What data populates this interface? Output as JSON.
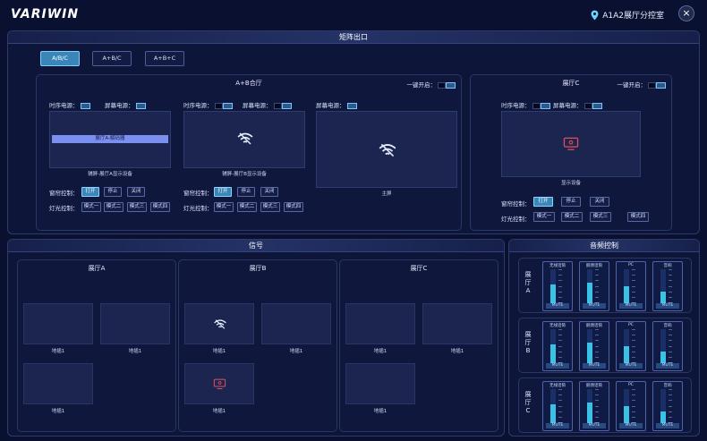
{
  "header": {
    "logo": "VARIWIN",
    "location": "A1A2展厅分控室",
    "close_symbol": "×"
  },
  "matrix": {
    "title": "矩阵出口",
    "modes": [
      "A/B/C",
      "A+B/C",
      "A+B+C"
    ],
    "active_mode": "A/B/C",
    "ab_hall": {
      "title": "A+B合厅",
      "one_key_label": "一键开启：",
      "power1_label": "时序电源：",
      "power2_label": "屏幕电源：",
      "decoder_label": "展厅A-解码器",
      "screen1_caption": "辅屏-展厅A显示设备",
      "screen2_caption": "辅屏-展厅B显示设备",
      "screen3_caption": "主屏",
      "curtain_label": "窗帘控制：",
      "light_label": "灯光控制：",
      "curtain_buttons": [
        "打开",
        "停止",
        "关闭"
      ],
      "light_buttons": [
        "模式一",
        "模式二",
        "模式三",
        "模式四"
      ]
    },
    "c_hall": {
      "title": "展厅C",
      "one_key_label": "一键开启：",
      "power1_label": "时序电源：",
      "power2_label": "屏幕电源：",
      "screen_caption": "显示设备",
      "curtain_label": "窗帘控制：",
      "light_label": "灯光控制：",
      "curtain_buttons": [
        "打开",
        "停止",
        "关闭"
      ],
      "light_buttons": [
        "模式一",
        "模式二",
        "模式三",
        "模式四"
      ]
    }
  },
  "signal": {
    "title": "信号",
    "halls": [
      {
        "title": "展厅A",
        "captions": [
          "地插1",
          "地插1",
          "地插1"
        ]
      },
      {
        "title": "展厅B",
        "captions": [
          "地插1",
          "地插1",
          "地插1"
        ]
      },
      {
        "title": "展厅C",
        "captions": [
          "地插1",
          "地插1",
          "地插1"
        ]
      }
    ]
  },
  "audio": {
    "title": "音频控制",
    "rows": [
      {
        "hall": "展厅A"
      },
      {
        "hall": "展厅B"
      },
      {
        "hall": "展厅C"
      }
    ],
    "channels": [
      "无线话筒",
      "鹅颈话筒",
      "PC",
      "音响"
    ],
    "mute_label": "MUTE",
    "levels": [
      [
        0.55,
        0.6,
        0.5,
        0.35
      ],
      [
        0.55,
        0.6,
        0.5,
        0.35
      ],
      [
        0.55,
        0.6,
        0.5,
        0.35
      ]
    ]
  },
  "colors": {
    "accent": "#3a86b8",
    "bar": "#39c1e6",
    "icon_red": "#e0505a"
  }
}
